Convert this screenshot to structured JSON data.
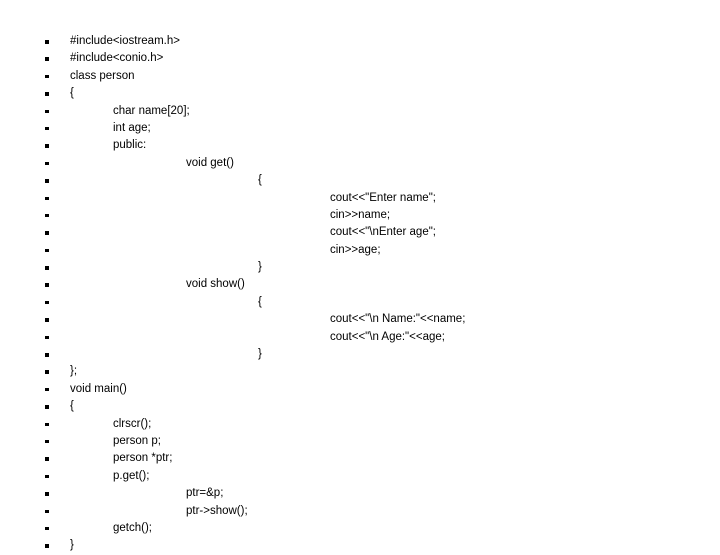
{
  "slide": {
    "background_color": "#ffffff",
    "text_color": "#000000",
    "bullet_glyph": "square-bullet"
  },
  "code": {
    "language": "C++",
    "lines": [
      {
        "text": "#include<iostream.h>",
        "indent": 1
      },
      {
        "text": "#include<conio.h>",
        "indent": 1
      },
      {
        "text": "class person",
        "indent": 1
      },
      {
        "text": "{",
        "indent": 1
      },
      {
        "text": "char name[20];",
        "indent": 2
      },
      {
        "text": "int age;",
        "indent": 2
      },
      {
        "text": "public:",
        "indent": 2
      },
      {
        "text": "void get()",
        "indent": 3
      },
      {
        "text": "{",
        "indent": 4
      },
      {
        "text": "cout<<\"Enter name\";",
        "indent": 5
      },
      {
        "text": "cin>>name;",
        "indent": 5
      },
      {
        "text": "cout<<\"\\nEnter age\";",
        "indent": 5
      },
      {
        "text": "cin>>age;",
        "indent": 5
      },
      {
        "text": "}",
        "indent": 4
      },
      {
        "text": "void show()",
        "indent": 3
      },
      {
        "text": "{",
        "indent": 4
      },
      {
        "text": "cout<<\"\\n Name:\"<<name;",
        "indent": 5
      },
      {
        "text": "cout<<\"\\n Age:\"<<age;",
        "indent": 5
      },
      {
        "text": "}",
        "indent": 4
      },
      {
        "text": "};",
        "indent": 1
      },
      {
        "text": "void main()",
        "indent": 1
      },
      {
        "text": "{",
        "indent": 1
      },
      {
        "text": "clrscr();",
        "indent": 2
      },
      {
        "text": "person p;",
        "indent": 2
      },
      {
        "text": "person *ptr;",
        "indent": 2
      },
      {
        "text": "p.get();",
        "indent": 2
      },
      {
        "text": "ptr=&p;",
        "indent": 3
      },
      {
        "text": "ptr->show();",
        "indent": 3
      },
      {
        "text": "getch();",
        "indent": 2
      },
      {
        "text": "}",
        "indent": 1
      }
    ]
  }
}
